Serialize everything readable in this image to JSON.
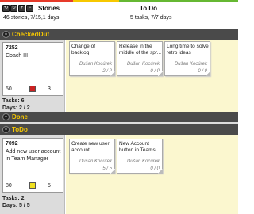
{
  "header": {
    "toolbar_buttons": [
      "toggle-icon",
      "refresh-icon",
      "expand-icon",
      "collapse-icon"
    ],
    "stories_title": "Stories",
    "stories_summary": "46 stories, 7/15,1 days",
    "todo_title": "To Do",
    "todo_summary": "5 tasks, 7/7 days",
    "colors": {
      "accent_red": "#e63a2a",
      "accent_yellow": "#f7c800",
      "accent_green": "#66b832",
      "lane_header_text": "#f7c800"
    }
  },
  "lanes": {
    "checkedout": {
      "label": "CheckedOut",
      "story": {
        "id": "7252",
        "title": "Coach III",
        "points": "50",
        "count": "3",
        "color": "#cc2222",
        "tasks_label": "Tasks: 6",
        "days_label": "Days:  2 / 2"
      },
      "tasks": [
        {
          "title": "Change of backlog",
          "owner": "Dušan Kocúrek",
          "progress": "2 / 2"
        },
        {
          "title": "Release in the middle of the spr...",
          "owner": "Dušan Kocúrek",
          "progress": "0 / 0"
        },
        {
          "title": "Long time to solve retro ideas",
          "owner": "Dušan Kocúrek",
          "progress": "0 / 0"
        }
      ]
    },
    "done": {
      "label": "Done"
    },
    "todo": {
      "label": "ToDo",
      "story": {
        "id": "7092",
        "title": "Add new user account in Team Manager",
        "points": "80",
        "count": "5",
        "color": "#f0e020",
        "tasks_label": "Tasks: 2",
        "days_label": "Days:  5 / 5"
      },
      "tasks": [
        {
          "title": "Create new user account",
          "owner": "Dušan Kocúrek",
          "progress": "5 / 5"
        },
        {
          "title": "New Account button in Teams...",
          "owner": "Dušan Kocúrek",
          "progress": "0 / 0"
        }
      ]
    }
  }
}
